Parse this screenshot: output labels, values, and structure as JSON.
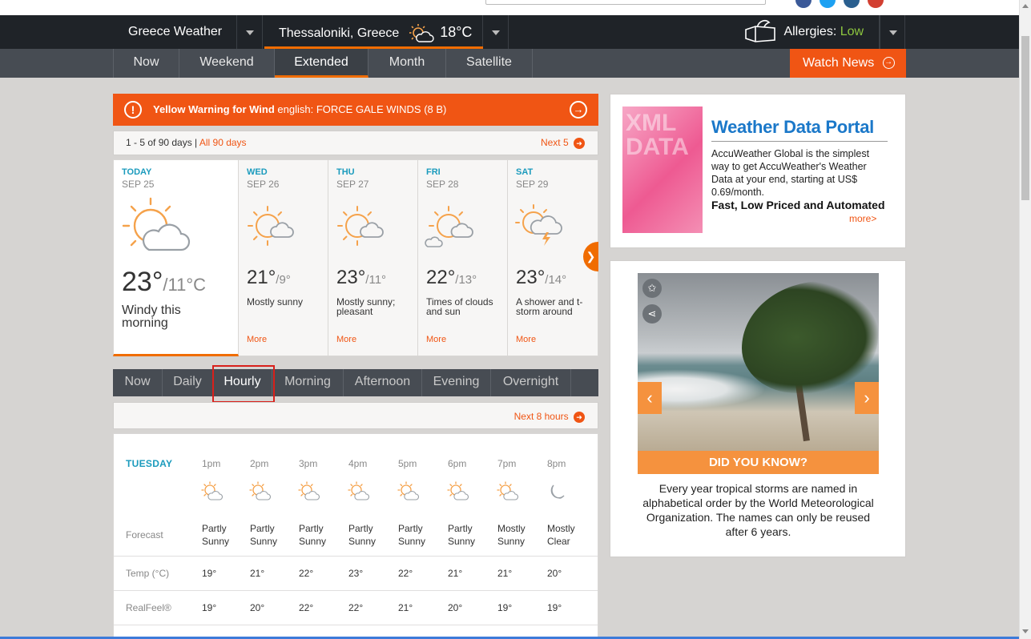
{
  "nav": {
    "region_label": "Greece Weather",
    "city_label": "Thessaloniki, Greece",
    "city_temp": "18°C",
    "allergies_label": "Allergies:",
    "allergies_value": "Low"
  },
  "subnav": {
    "tabs": [
      {
        "label": "Now"
      },
      {
        "label": "Weekend"
      },
      {
        "label": "Extended",
        "active": true
      },
      {
        "label": "Month"
      },
      {
        "label": "Satellite"
      }
    ],
    "watch_news": "Watch News"
  },
  "warning": {
    "title": "Yellow Warning for Wind",
    "detail": "english: FORCE GALE WINDS (8 B)"
  },
  "daysbar": {
    "range": "1 - 5 of 90 days |",
    "all_link": "All 90 days",
    "next": "Next 5"
  },
  "forecast": [
    {
      "day": "TODAY",
      "date": "SEP 25",
      "hi": "23°",
      "lo": "/11°C",
      "desc": "Windy this morning",
      "icon": "partly-sunny-icon"
    },
    {
      "day": "WED",
      "date": "SEP 26",
      "hi": "21°",
      "lo": "/9°",
      "desc": "Mostly sunny",
      "more": "More",
      "icon": "mostly-sunny-icon"
    },
    {
      "day": "THU",
      "date": "SEP 27",
      "hi": "23°",
      "lo": "/11°",
      "desc": "Mostly sunny; pleasant",
      "more": "More",
      "icon": "mostly-sunny-icon"
    },
    {
      "day": "FRI",
      "date": "SEP 28",
      "hi": "22°",
      "lo": "/13°",
      "desc": "Times of clouds and sun",
      "more": "More",
      "icon": "clouds-and-sun-icon"
    },
    {
      "day": "SAT",
      "date": "SEP 29",
      "hi": "23°",
      "lo": "/14°",
      "desc": "A shower and t-storm around",
      "more": "More",
      "icon": "t-storm-icon"
    }
  ],
  "hourly_tabs": [
    {
      "label": "Now"
    },
    {
      "label": "Daily"
    },
    {
      "label": "Hourly",
      "active": true
    },
    {
      "label": "Morning"
    },
    {
      "label": "Afternoon"
    },
    {
      "label": "Evening"
    },
    {
      "label": "Overnight"
    }
  ],
  "next_hours": "Next 8 hours",
  "hourly": {
    "day": "TUESDAY",
    "forecast_label": "Forecast",
    "temp_label": "Temp (°C)",
    "realfeel_label": "RealFeel®",
    "hours": [
      {
        "time": "1pm",
        "forecast": [
          "Partly",
          "Sunny"
        ],
        "temp": "19°",
        "realfeel": "19°",
        "icon": "partly-sunny-icon"
      },
      {
        "time": "2pm",
        "forecast": [
          "Partly",
          "Sunny"
        ],
        "temp": "21°",
        "realfeel": "20°",
        "icon": "partly-sunny-icon"
      },
      {
        "time": "3pm",
        "forecast": [
          "Partly",
          "Sunny"
        ],
        "temp": "22°",
        "realfeel": "22°",
        "icon": "partly-sunny-icon"
      },
      {
        "time": "4pm",
        "forecast": [
          "Partly",
          "Sunny"
        ],
        "temp": "23°",
        "realfeel": "22°",
        "icon": "partly-sunny-icon"
      },
      {
        "time": "5pm",
        "forecast": [
          "Partly",
          "Sunny"
        ],
        "temp": "22°",
        "realfeel": "21°",
        "icon": "partly-sunny-icon"
      },
      {
        "time": "6pm",
        "forecast": [
          "Partly",
          "Sunny"
        ],
        "temp": "21°",
        "realfeel": "20°",
        "icon": "partly-sunny-icon"
      },
      {
        "time": "7pm",
        "forecast": [
          "Mostly",
          "Sunny"
        ],
        "temp": "21°",
        "realfeel": "19°",
        "icon": "mostly-sunny-icon"
      },
      {
        "time": "8pm",
        "forecast": [
          "Mostly",
          "Clear"
        ],
        "temp": "20°",
        "realfeel": "19°",
        "icon": "moon-icon"
      }
    ]
  },
  "ad": {
    "title": "Weather Data Portal",
    "body": "AccuWeather Global is the simplest way to get AccuWeather's Weather Data at your end, starting at US$ 0.69/month.",
    "tagline": "Fast, Low Priced and Automated",
    "more": "more>",
    "image_text": "XML DATA"
  },
  "did_you_know": {
    "banner": "DID YOU KNOW?",
    "fact": "Every year tropical storms are named in alphabetical order by the World Meteorological Organization. The names can only be reused after 6 years."
  },
  "colors": {
    "accent": "#f05514",
    "link_blue": "#1b9bbd",
    "nav_dark": "#1f2328",
    "nav_mid": "#474c53",
    "allergy_green": "#8dc63f"
  }
}
